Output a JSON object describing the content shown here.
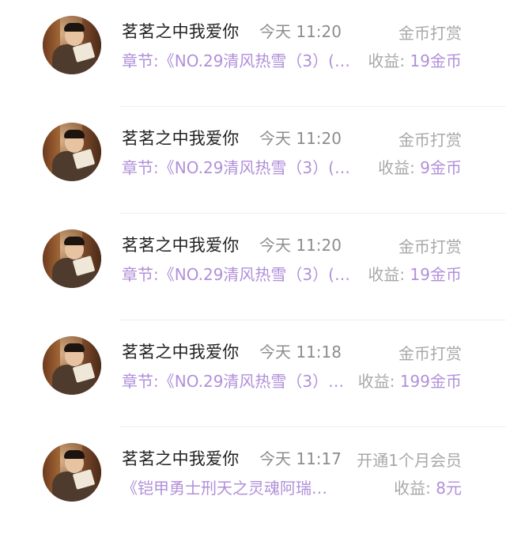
{
  "records": [
    {
      "user": "茗茗之中我爱你",
      "time": "今天 11:20",
      "type": "金币打赏",
      "title": "章节:《NO.29清风热雪（3）(…",
      "earn_label": "收益:",
      "earn_value": "19金币"
    },
    {
      "user": "茗茗之中我爱你",
      "time": "今天 11:20",
      "type": "金币打赏",
      "title": "章节:《NO.29清风热雪（3）(…",
      "earn_label": "收益:",
      "earn_value": "9金币"
    },
    {
      "user": "茗茗之中我爱你",
      "time": "今天 11:20",
      "type": "金币打赏",
      "title": "章节:《NO.29清风热雪（3）(…",
      "earn_label": "收益:",
      "earn_value": "19金币"
    },
    {
      "user": "茗茗之中我爱你",
      "time": "今天 11:18",
      "type": "金币打赏",
      "title": "章节:《NO.29清风热雪（3）…",
      "earn_label": "收益:",
      "earn_value": "199金币"
    },
    {
      "user": "茗茗之中我爱你",
      "time": "今天 11:17",
      "type": "开通1个月会员",
      "title": "《铠甲勇士刑天之灵魂阿瑞…",
      "earn_label": "收益:",
      "earn_value": "8元"
    }
  ]
}
